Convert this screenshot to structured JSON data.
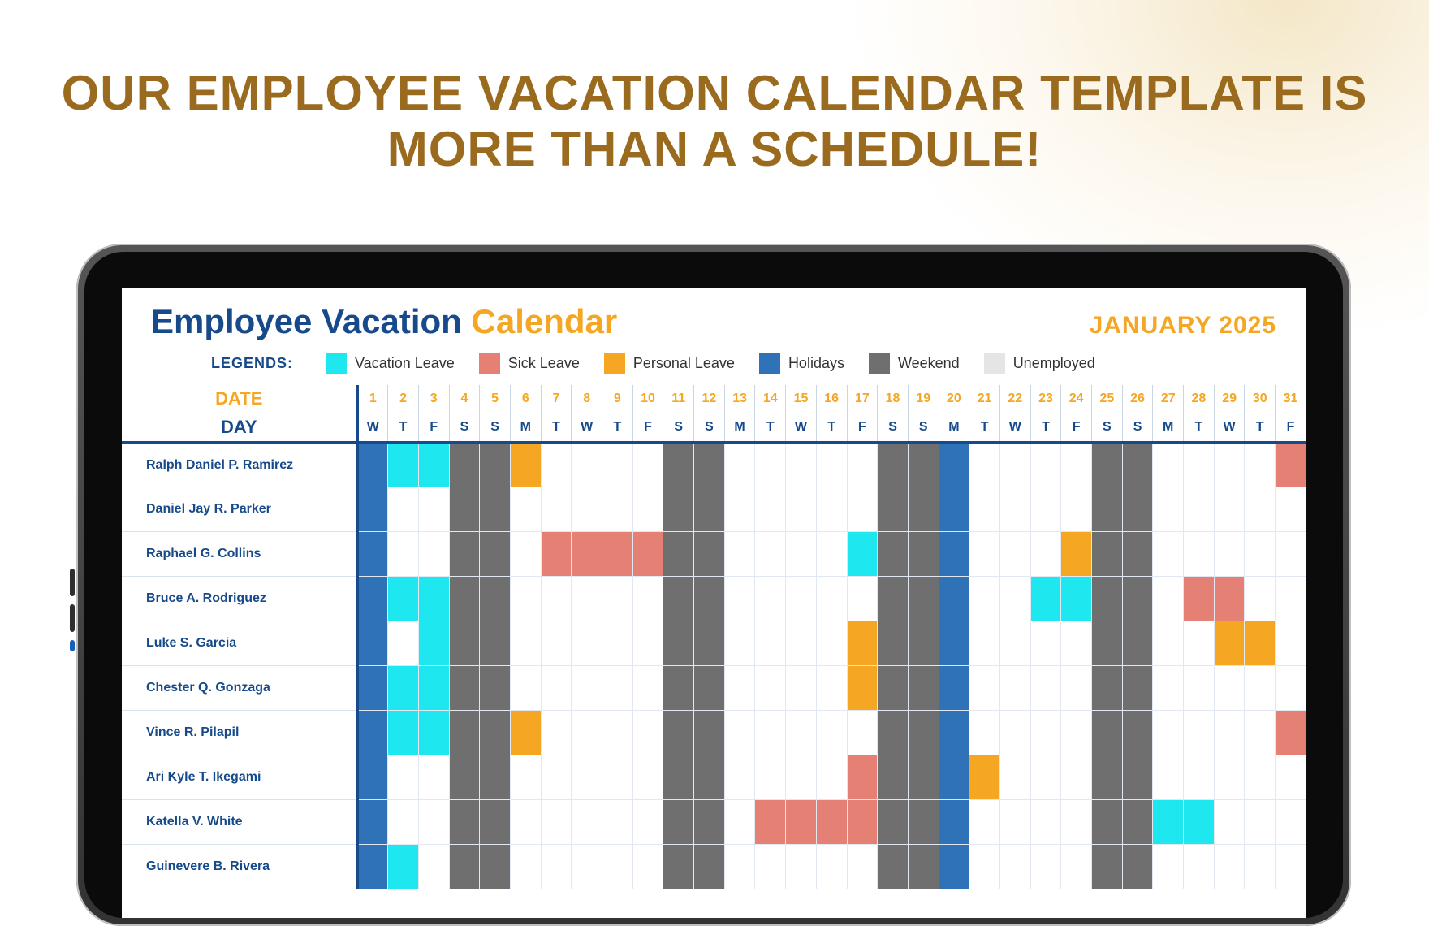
{
  "headline": "OUR EMPLOYEE VACATION CALENDAR TEMPLATE IS MORE THAN A SCHEDULE!",
  "screen": {
    "title_a": "Employee Vacation ",
    "title_b": "Calendar",
    "month": "JANUARY 2025",
    "legends_caption": "LEGENDS:",
    "legends": [
      {
        "label": "Vacation Leave",
        "cls": "c-vac"
      },
      {
        "label": "Sick Leave",
        "cls": "c-sick"
      },
      {
        "label": "Personal Leave",
        "cls": "c-pers"
      },
      {
        "label": "Holidays",
        "cls": "c-hol"
      },
      {
        "label": "Weekend",
        "cls": "c-wknd"
      },
      {
        "label": "Unemployed",
        "cls": "c-unemp"
      }
    ],
    "date_label": "DATE",
    "day_label": "DAY",
    "dates": [
      1,
      2,
      3,
      4,
      5,
      6,
      7,
      8,
      9,
      10,
      11,
      12,
      13,
      14,
      15,
      16,
      17,
      18,
      19,
      20,
      21,
      22,
      23,
      24,
      25,
      26,
      27,
      28,
      29,
      30,
      31
    ],
    "dows": [
      "W",
      "T",
      "F",
      "S",
      "S",
      "M",
      "T",
      "W",
      "T",
      "F",
      "S",
      "S",
      "M",
      "T",
      "W",
      "T",
      "F",
      "S",
      "S",
      "M",
      "T",
      "W",
      "T",
      "F",
      "S",
      "S",
      "M",
      "T",
      "W",
      "T",
      "F"
    ],
    "employees": [
      {
        "name": "Ralph Daniel P. Ramirez",
        "cells": [
          "hol",
          "vac",
          "vac",
          "wknd",
          "wknd",
          "pers",
          "",
          "",
          "",
          "",
          "wknd",
          "wknd",
          "",
          "",
          "",
          "",
          "",
          "wknd",
          "wknd",
          "hol",
          "",
          "",
          "",
          "",
          "wknd",
          "wknd",
          "",
          "",
          "",
          "",
          "sick"
        ]
      },
      {
        "name": "Daniel Jay R. Parker",
        "cells": [
          "hol",
          "",
          "",
          "wknd",
          "wknd",
          "",
          "",
          "",
          "",
          "",
          "wknd",
          "wknd",
          "",
          "",
          "",
          "",
          "",
          "wknd",
          "wknd",
          "hol",
          "",
          "",
          "",
          "",
          "wknd",
          "wknd",
          "",
          "",
          "",
          "",
          ""
        ]
      },
      {
        "name": "Raphael G. Collins",
        "cells": [
          "hol",
          "",
          "",
          "wknd",
          "wknd",
          "",
          "sick",
          "sick",
          "sick",
          "sick",
          "wknd",
          "wknd",
          "",
          "",
          "",
          "",
          "vac",
          "wknd",
          "wknd",
          "hol",
          "",
          "",
          "",
          "pers",
          "wknd",
          "wknd",
          "",
          "",
          "",
          "",
          ""
        ]
      },
      {
        "name": "Bruce A. Rodriguez",
        "cells": [
          "hol",
          "vac",
          "vac",
          "wknd",
          "wknd",
          "",
          "",
          "",
          "",
          "",
          "wknd",
          "wknd",
          "",
          "",
          "",
          "",
          "",
          "wknd",
          "wknd",
          "hol",
          "",
          "",
          "vac",
          "vac",
          "wknd",
          "wknd",
          "",
          "sick",
          "sick",
          "",
          ""
        ]
      },
      {
        "name": "Luke S. Garcia",
        "cells": [
          "hol",
          "",
          "vac",
          "wknd",
          "wknd",
          "",
          "",
          "",
          "",
          "",
          "wknd",
          "wknd",
          "",
          "",
          "",
          "",
          "pers",
          "wknd",
          "wknd",
          "hol",
          "",
          "",
          "",
          "",
          "wknd",
          "wknd",
          "",
          "",
          "pers",
          "pers",
          ""
        ]
      },
      {
        "name": "Chester Q. Gonzaga",
        "cells": [
          "hol",
          "vac",
          "vac",
          "wknd",
          "wknd",
          "",
          "",
          "",
          "",
          "",
          "wknd",
          "wknd",
          "",
          "",
          "",
          "",
          "pers",
          "wknd",
          "wknd",
          "hol",
          "",
          "",
          "",
          "",
          "wknd",
          "wknd",
          "",
          "",
          "",
          "",
          ""
        ]
      },
      {
        "name": "Vince R. Pilapil",
        "cells": [
          "hol",
          "vac",
          "vac",
          "wknd",
          "wknd",
          "pers",
          "",
          "",
          "",
          "",
          "wknd",
          "wknd",
          "",
          "",
          "",
          "",
          "",
          "wknd",
          "wknd",
          "hol",
          "",
          "",
          "",
          "",
          "wknd",
          "wknd",
          "",
          "",
          "",
          "",
          "sick"
        ]
      },
      {
        "name": "Ari Kyle T. Ikegami",
        "cells": [
          "hol",
          "",
          "",
          "wknd",
          "wknd",
          "",
          "",
          "",
          "",
          "",
          "wknd",
          "wknd",
          "",
          "",
          "",
          "",
          "sick",
          "wknd",
          "wknd",
          "hol",
          "pers",
          "",
          "",
          "",
          "wknd",
          "wknd",
          "",
          "",
          "",
          "",
          ""
        ]
      },
      {
        "name": "Katella V. White",
        "cells": [
          "hol",
          "",
          "",
          "wknd",
          "wknd",
          "",
          "",
          "",
          "",
          "",
          "wknd",
          "wknd",
          "",
          "sick",
          "sick",
          "sick",
          "sick",
          "wknd",
          "wknd",
          "hol",
          "",
          "",
          "",
          "",
          "wknd",
          "wknd",
          "vac",
          "vac",
          "",
          "",
          ""
        ]
      },
      {
        "name": "Guinevere B. Rivera",
        "cells": [
          "hol",
          "vac",
          "",
          "wknd",
          "wknd",
          "",
          "",
          "",
          "",
          "",
          "wknd",
          "wknd",
          "",
          "",
          "",
          "",
          "",
          "wknd",
          "wknd",
          "hol",
          "",
          "",
          "",
          "",
          "wknd",
          "wknd",
          "",
          "",
          "",
          "",
          ""
        ]
      }
    ]
  },
  "colors": {
    "hol": "c-hol",
    "vac": "c-vac",
    "sick": "c-sick",
    "pers": "c-pers",
    "wknd": "c-wknd",
    "unemp": "c-unemp"
  }
}
